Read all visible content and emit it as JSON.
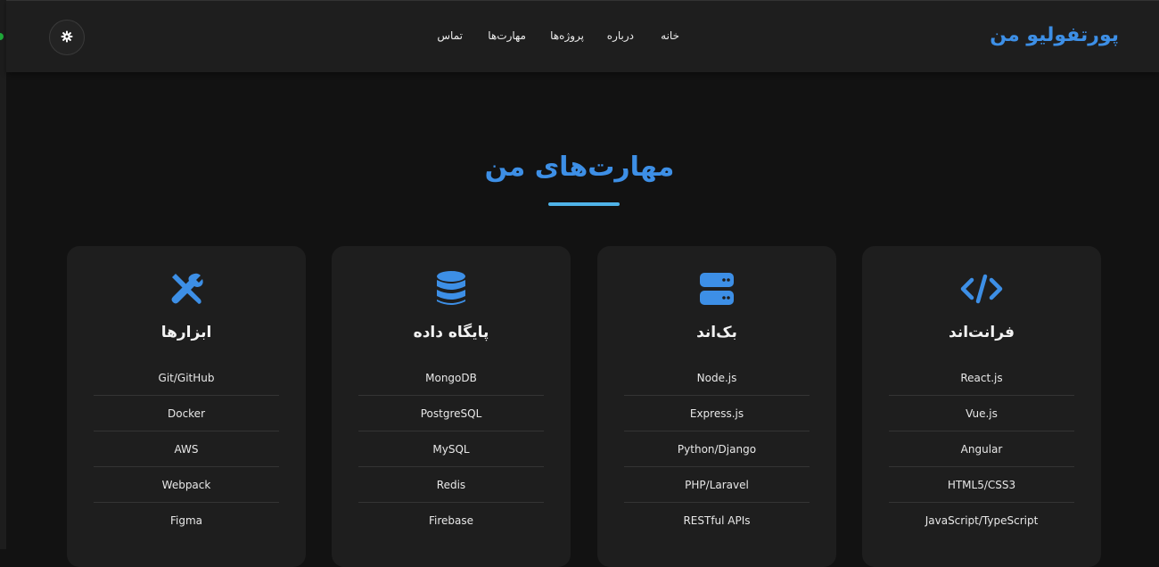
{
  "header": {
    "brand": "پورتفولیو من",
    "nav": [
      "خانه",
      "درباره",
      "پروژه‌ها",
      "مهارت‌ها",
      "تماس"
    ],
    "theme_toggle_icon": "gear-icon"
  },
  "skills": {
    "title": "مهارت‌های من",
    "accent": "#3d8fe6",
    "cards": [
      {
        "title": "فرانت‌اند",
        "icon": "code-icon",
        "items": [
          "React.js",
          "Vue.js",
          "Angular",
          "HTML5/CSS3",
          "JavaScript/TypeScript"
        ]
      },
      {
        "title": "بک‌اند",
        "icon": "server-icon",
        "items": [
          "Node.js",
          "Express.js",
          "Python/Django",
          "PHP/Laravel",
          "RESTful APIs"
        ]
      },
      {
        "title": "پایگاه داده",
        "icon": "database-icon",
        "items": [
          "MongoDB",
          "PostgreSQL",
          "MySQL",
          "Redis",
          "Firebase"
        ]
      },
      {
        "title": "ابزارها",
        "icon": "tools-icon",
        "items": [
          "Git/GitHub",
          "Docker",
          "AWS",
          "Webpack",
          "Figma"
        ]
      }
    ]
  }
}
